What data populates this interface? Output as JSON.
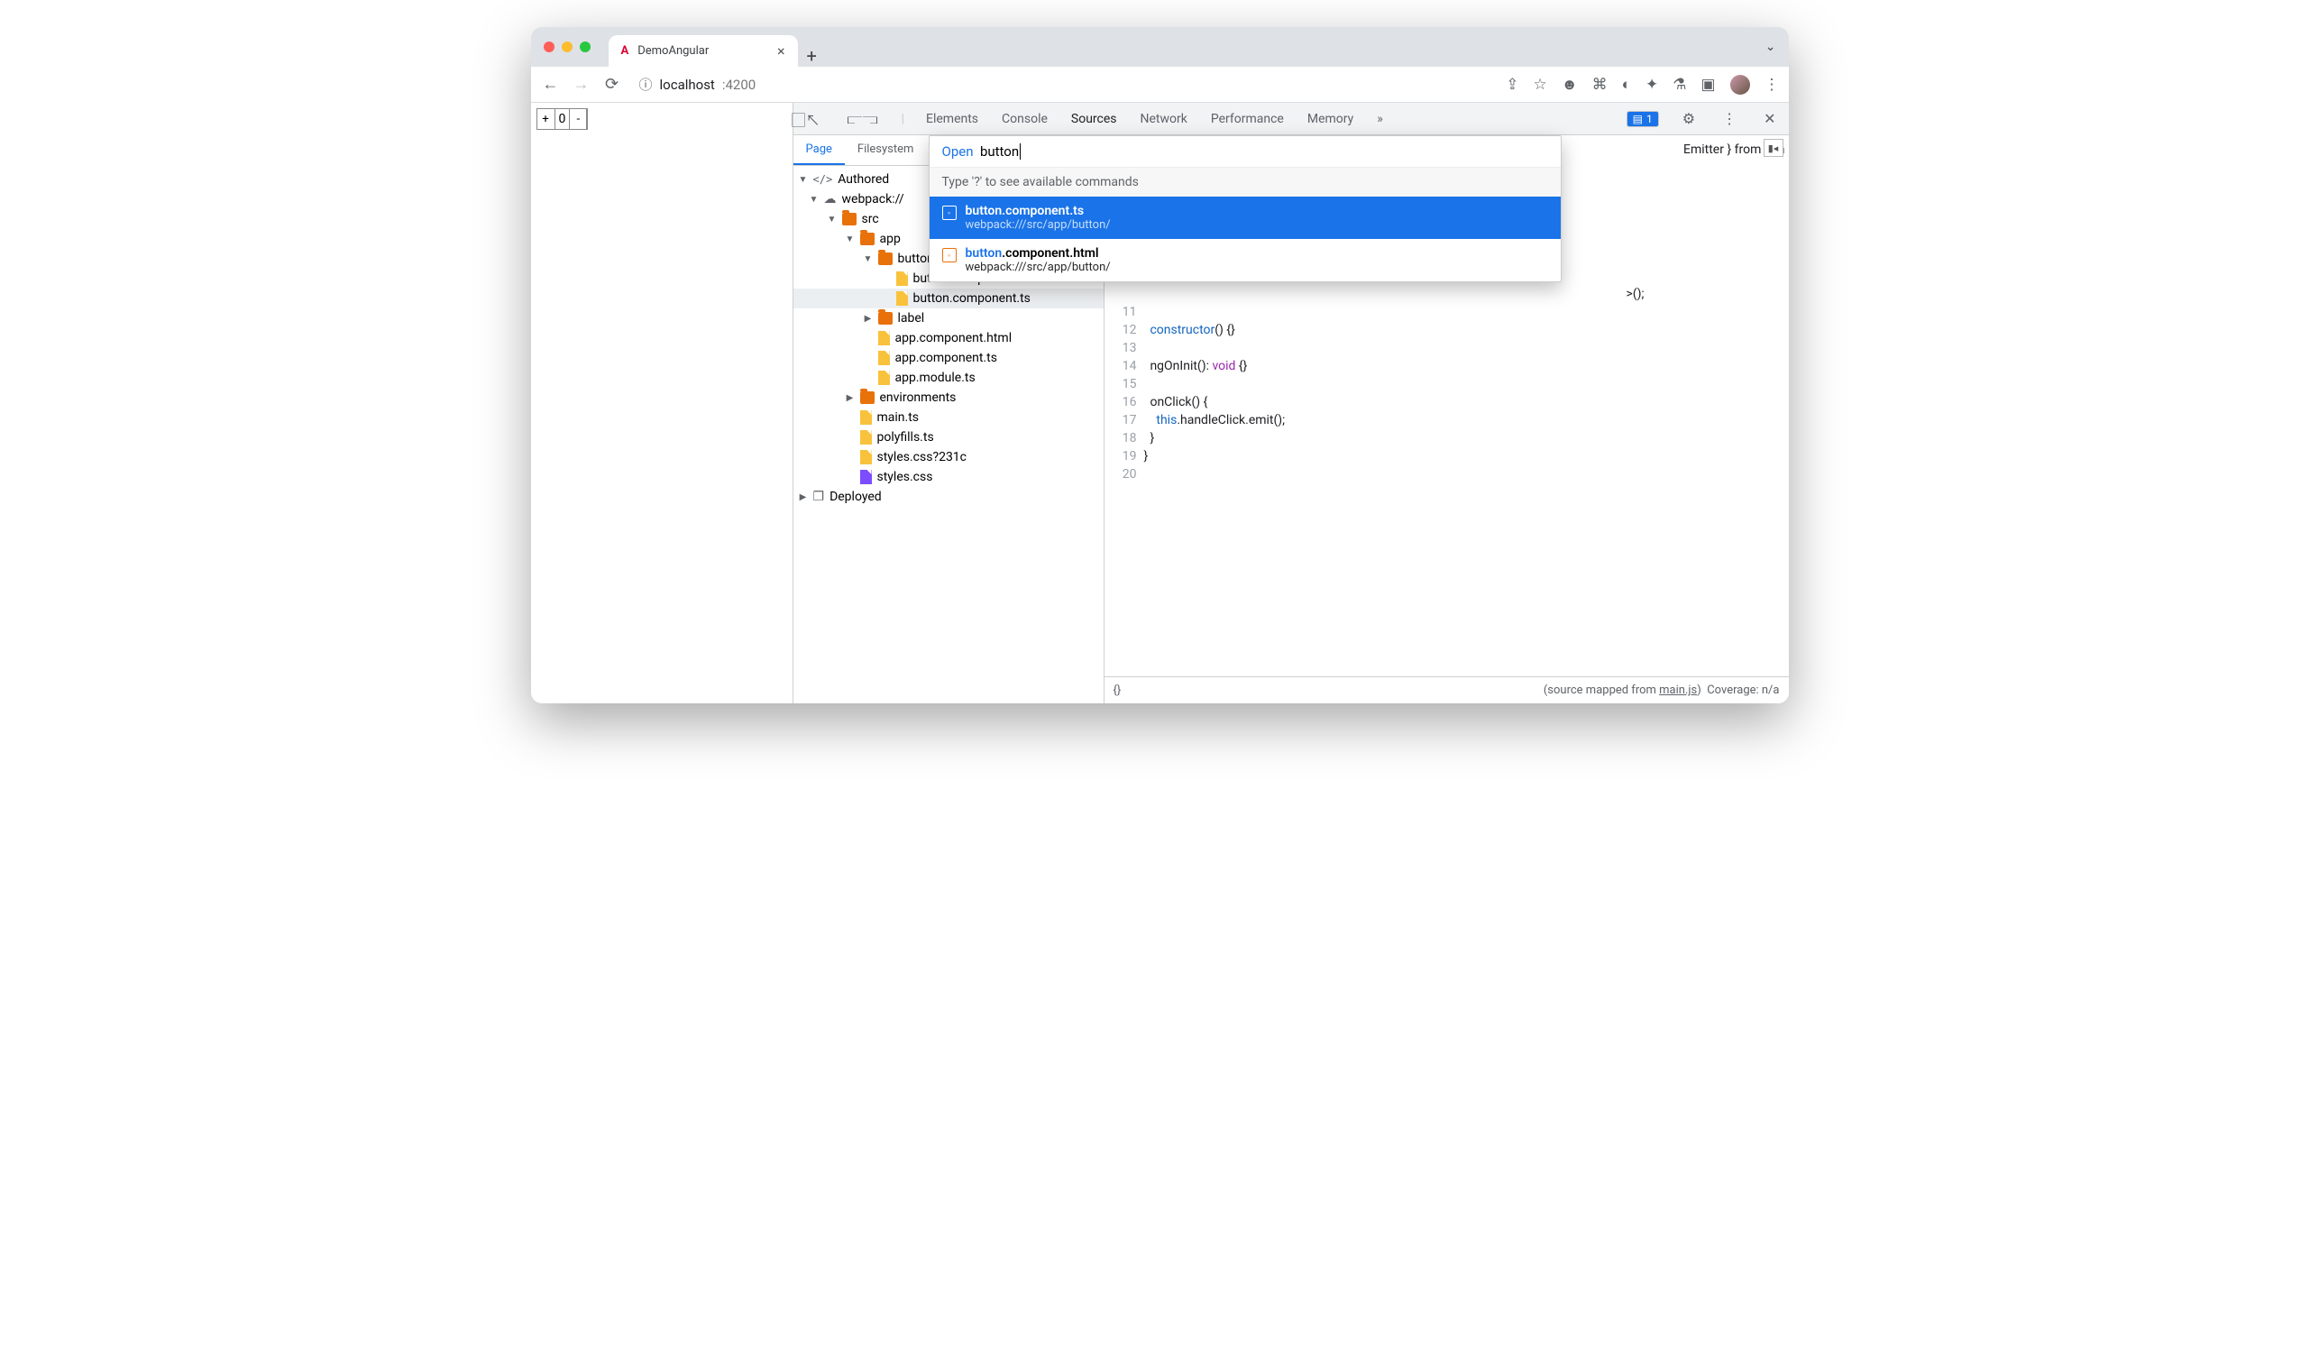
{
  "browser": {
    "tab_title": "DemoAngular",
    "url_host": "localhost",
    "url_port": ":4200",
    "info_icon": "ⓘ"
  },
  "page": {
    "counter_plus": "+",
    "counter_value": "0",
    "counter_minus": "-"
  },
  "devtools": {
    "tabs": [
      "Elements",
      "Console",
      "Sources",
      "Network",
      "Performance",
      "Memory"
    ],
    "active_tab": "Sources",
    "more": "»",
    "issues_count": "1",
    "subtabs": [
      "Page",
      "Filesystem"
    ],
    "active_subtab": "Page"
  },
  "tree": {
    "authored": "Authored",
    "webpack": "webpack://",
    "src": "src",
    "app": "app",
    "button_folder": "button",
    "button_html": "button.component.html",
    "button_ts": "button.component.ts",
    "label_folder": "label",
    "app_html": "app.component.html",
    "app_ts": "app.component.ts",
    "app_module": "app.module.ts",
    "env": "environments",
    "main": "main.ts",
    "polyfills": "polyfills.ts",
    "styles_q": "styles.css?231c",
    "styles": "styles.css",
    "deployed": "Deployed"
  },
  "popup": {
    "open_label": "Open",
    "query": "button",
    "hint": "Type '?' to see available commands",
    "item1_title": "button.component.ts",
    "item1_path": "webpack:///src/app/button/",
    "item2_match": "button",
    "item2_rest": ".component.html",
    "item2_path": "webpack:///src/app/button/"
  },
  "code": {
    "snippet_top": "Emitter } from '@a",
    "frag_from": "from",
    "l11": "11",
    "l12": "12",
    "l13": "13",
    "l14": "14",
    "l15": "15",
    "l16": "16",
    "l17": "17",
    "l18": "18",
    "l19": "19",
    "l20": "20",
    "c12a": "constructor",
    "c12b": "() {}",
    "c14a": "ngOnInit(): ",
    "c14b": "void",
    "c14c": " {}",
    "c16": "onClick() {",
    "c17a": "this",
    "c17b": ".handleClick.emit();",
    "c18": "}",
    "c19": "}",
    "cbrace_top": ">();"
  },
  "status": {
    "left": "{}",
    "mapped": "(source mapped from ",
    "mapped_link": "main.js",
    "mapped_close": ")",
    "coverage": "Coverage: n/a"
  }
}
